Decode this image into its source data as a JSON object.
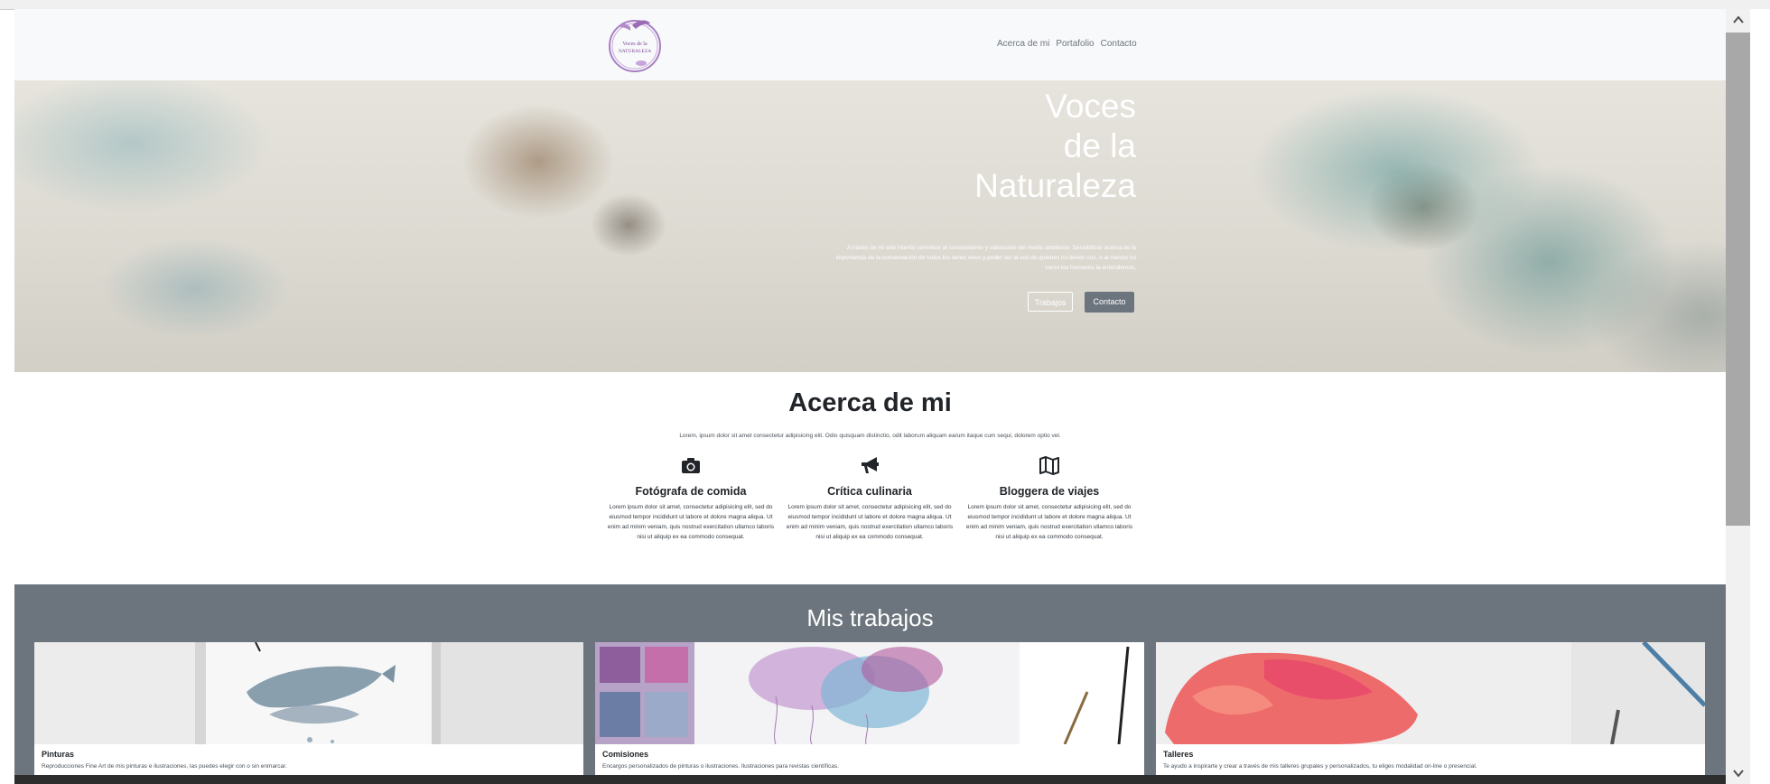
{
  "logo": {
    "text_line1": "Voces de la",
    "text_line2": "NATURALEZA"
  },
  "nav": {
    "links": [
      "Acerca de mi",
      "Portafolio",
      "Contacto"
    ]
  },
  "hero": {
    "title_lines": [
      "Voces",
      "de la",
      "Naturaleza"
    ],
    "lead": "A través de mi arte intento contribuir al conocimiento y valoración del medio ambiente. Sensibilizar acerca de la importancia de la conservación de todos los seres vivos y poder ser la voz de quienes no tienen voz, o al menos no como los humanos la entendemos.",
    "button_primary": "Trabajos",
    "button_secondary": "Contacto"
  },
  "about": {
    "title": "Acerca de mi",
    "lead": "Lorem, ipsum dolor sit amet consectetur adipisicing elit. Odio quisquam distinctio, odit laborum aliquam earum itaque cum sequi, dolorem optio vel.",
    "features": [
      {
        "icon": "camera-icon",
        "title": "Fotógrafa de comida",
        "text": "Lorem ipsum dolor sit amet, consectetur adipisicing elit, sed do eiusmod tempor incididunt ut labore et dolore magna aliqua. Ut enim ad minim veniam, quis nostrud exercitation ullamco laboris nisi ut aliquip ex ea commodo consequat."
      },
      {
        "icon": "megaphone-icon",
        "title": "Crítica culinaria",
        "text": "Lorem ipsum dolor sit amet, consectetur adipisicing elit, sed do eiusmod tempor incididunt ut labore et dolore magna aliqua. Ut enim ad minim veniam, quis nostrud exercitation ullamco laboris nisi ut aliquip ex ea commodo consequat."
      },
      {
        "icon": "map-icon",
        "title": "Bloggera de viajes",
        "text": "Lorem ipsum dolor sit amet, consectetur adipisicing elit, sed do eiusmod tempor incididunt ut labore et dolore magna aliqua. Ut enim ad minim veniam, quis nostrud exercitation ullamco laboris nisi ut aliquip ex ea commodo consequat."
      }
    ]
  },
  "works": {
    "title": "Mis trabajos",
    "cards": [
      {
        "name": "Pinturas",
        "desc": "Reproducciones Fine Art de mis pinturas e ilustraciones, las puedes elegir con o sin enmarcar."
      },
      {
        "name": "Comisiones",
        "desc": "Encargos personalizados de pinturas o ilustraciones. Ilustraciones para revistas científicas."
      },
      {
        "name": "Talleres",
        "desc": "Te ayudo a inspirarte y crear a través de mis talleres grupales y personalizados, tu eliges modalidad on-line o presencial."
      }
    ]
  },
  "colors": {
    "navbar_bg": "#f8f9fa",
    "secondary": "#6c757d",
    "logo_purple": "#9b6bb5"
  }
}
